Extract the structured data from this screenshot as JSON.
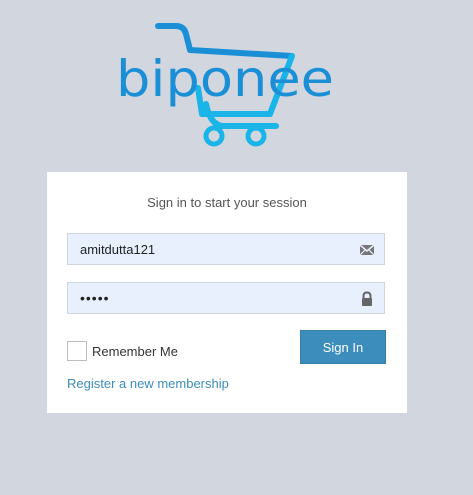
{
  "brand": {
    "logo_text": "biponee",
    "logo_color": "#1a8fd6",
    "icon": "shopping-cart-icon"
  },
  "login": {
    "message": "Sign in to start your session",
    "username": {
      "value": "amitdutta121",
      "icon": "envelope-icon"
    },
    "password": {
      "value": "•••••",
      "icon": "lock-icon"
    },
    "remember_label": "Remember Me",
    "remember_checked": false,
    "signin_label": "Sign In",
    "register_label": "Register a new membership"
  },
  "colors": {
    "background": "#d2d6de",
    "primary": "#3c8dbc",
    "input_bg": "#e8f0fe"
  }
}
